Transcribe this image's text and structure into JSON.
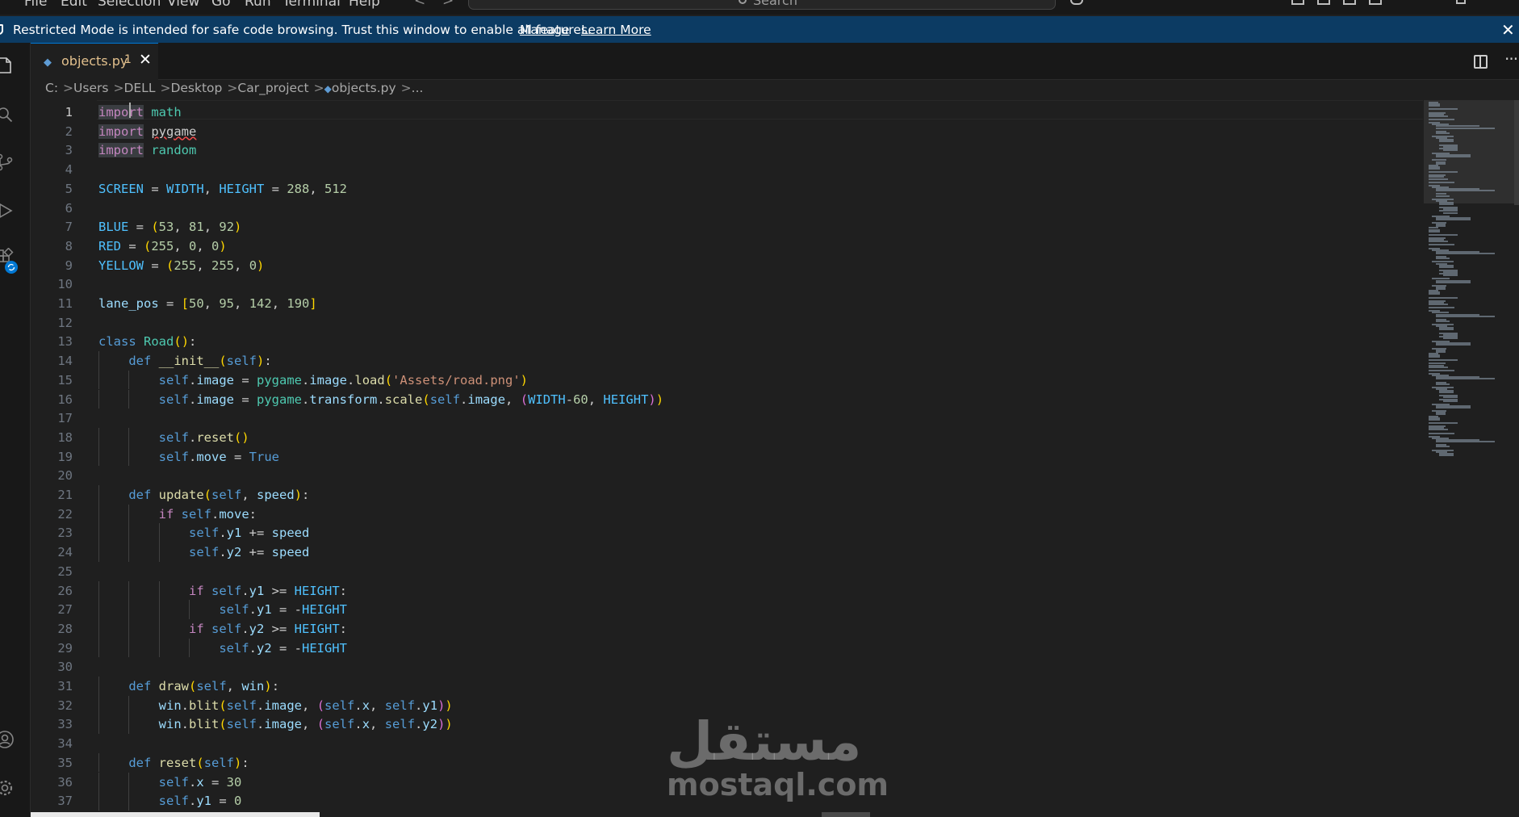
{
  "menu": [
    "File",
    "Edit",
    "Selection",
    "View",
    "Go",
    "Run",
    "Terminal",
    "Help"
  ],
  "search": {
    "placeholder": "Search"
  },
  "banner": {
    "message": "Restricted Mode is intended for safe code browsing. Trust this window to enable all features.",
    "manage_label": "Manage",
    "learn_more_label": "Learn More"
  },
  "tab": {
    "filename": "objects.py",
    "problem_count": "1"
  },
  "breadcrumb": [
    "C:",
    "Users",
    "DELL",
    "Desktop",
    "Car_project",
    "objects.py",
    "..."
  ],
  "colors": {
    "banner": "#0c3b63",
    "editor_bg": "#1f1f1f",
    "tab_modified_text": "#e2c08d",
    "accent": "#0078d4"
  },
  "icons": [
    "explorer-icon",
    "search-icon",
    "source-control-icon",
    "run-debug-icon",
    "extensions-icon",
    "account-icon",
    "manage-gear-icon",
    "split-editor-icon",
    "more-actions-icon",
    "close-icon",
    "python-file-icon"
  ],
  "editor": {
    "active_line": 1,
    "line_numbers": [
      "1",
      "2",
      "3",
      "4",
      "5",
      "6",
      "7",
      "8",
      "9",
      "10",
      "11",
      "12",
      "13",
      "14",
      "15",
      "16",
      "17",
      "18",
      "19",
      "20",
      "21",
      "22",
      "23",
      "24",
      "25",
      "26",
      "27",
      "28",
      "29",
      "30",
      "31",
      "32",
      "33",
      "34",
      "35",
      "36",
      "37"
    ],
    "lines": [
      "import math",
      "import pygame",
      "import random",
      "",
      "SCREEN = WIDTH, HEIGHT = 288, 512",
      "",
      "BLUE = (53, 81, 92)",
      "RED = (255, 0, 0)",
      "YELLOW = (255, 255, 0)",
      "",
      "lane_pos = [50, 95, 142, 190]",
      "",
      "class Road():",
      "    def __init__(self):",
      "        self.image = pygame.image.load('Assets/road.png')",
      "        self.image = pygame.transform.scale(self.image, (WIDTH-60, HEIGHT))",
      "",
      "        self.reset()",
      "        self.move = True",
      "",
      "    def update(self, speed):",
      "        if self.move:",
      "            self.y1 += speed",
      "            self.y2 += speed",
      "",
      "            if self.y1 >= HEIGHT:",
      "                self.y1 = -HEIGHT",
      "            if self.y2 >= HEIGHT:",
      "                self.y2 = -HEIGHT",
      "",
      "    def draw(self, win):",
      "        win.blit(self.image, (self.x, self.y1))",
      "        win.blit(self.image, (self.x, self.y2))",
      "",
      "    def reset(self):",
      "        self.x = 30",
      "        self.y1 = 0"
    ]
  },
  "watermark": {
    "arabic": "مستقل",
    "latin": "mostaql.com"
  }
}
